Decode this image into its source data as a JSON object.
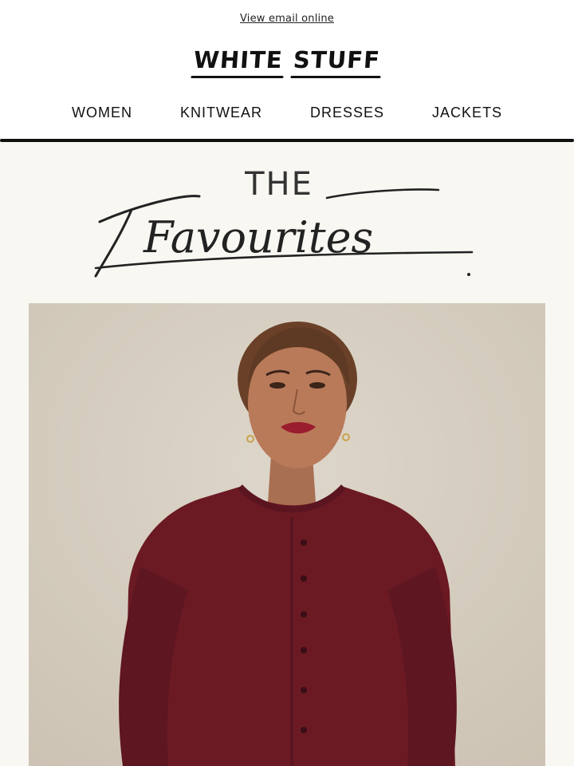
{
  "header": {
    "view_online": "View email online",
    "logo_word_1": "WHITE",
    "logo_word_2": "STUFF"
  },
  "nav": {
    "items": [
      {
        "label": "WOMEN"
      },
      {
        "label": "KNITWEAR"
      },
      {
        "label": "DRESSES"
      },
      {
        "label": "JACKETS"
      }
    ]
  },
  "hero": {
    "title_top": "THE",
    "title_script": "Favourites"
  },
  "image": {
    "description_icon": "model-photo",
    "colors": {
      "background": "#d8d0c4",
      "cardigan": "#6b1a24",
      "skin": "#b97a5a",
      "hair": "#6a4128"
    }
  }
}
